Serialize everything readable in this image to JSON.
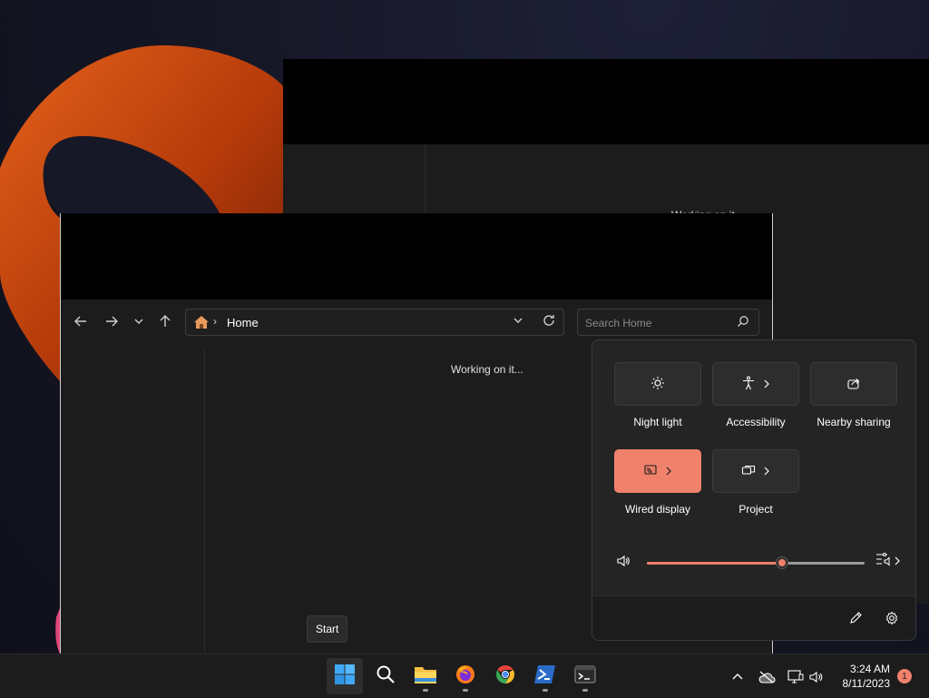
{
  "explorer": {
    "breadcrumb_home": "Home",
    "search_placeholder": "Search Home",
    "status_text": "Working on it...",
    "back_ghost_text": "Working on it..."
  },
  "tooltip": {
    "text": "Start"
  },
  "quick_settings": {
    "tiles": [
      {
        "label": "Night light",
        "icon": "brightness-icon",
        "active": false,
        "has_chevron": false
      },
      {
        "label": "Accessibility",
        "icon": "accessibility-icon",
        "active": false,
        "has_chevron": true
      },
      {
        "label": "Nearby sharing",
        "icon": "share-icon",
        "active": false,
        "has_chevron": false
      },
      {
        "label": "Wired display",
        "icon": "cast-icon",
        "active": true,
        "has_chevron": true
      },
      {
        "label": "Project",
        "icon": "project-icon",
        "active": false,
        "has_chevron": true
      }
    ],
    "volume_percent": 62,
    "accent_color": "#f0826b"
  },
  "taskbar": {
    "apps": [
      "start",
      "search",
      "file-explorer",
      "firefox",
      "chrome",
      "powershell",
      "terminal"
    ],
    "time": "3:24 AM",
    "date": "8/11/2023",
    "notification_count": "1"
  }
}
